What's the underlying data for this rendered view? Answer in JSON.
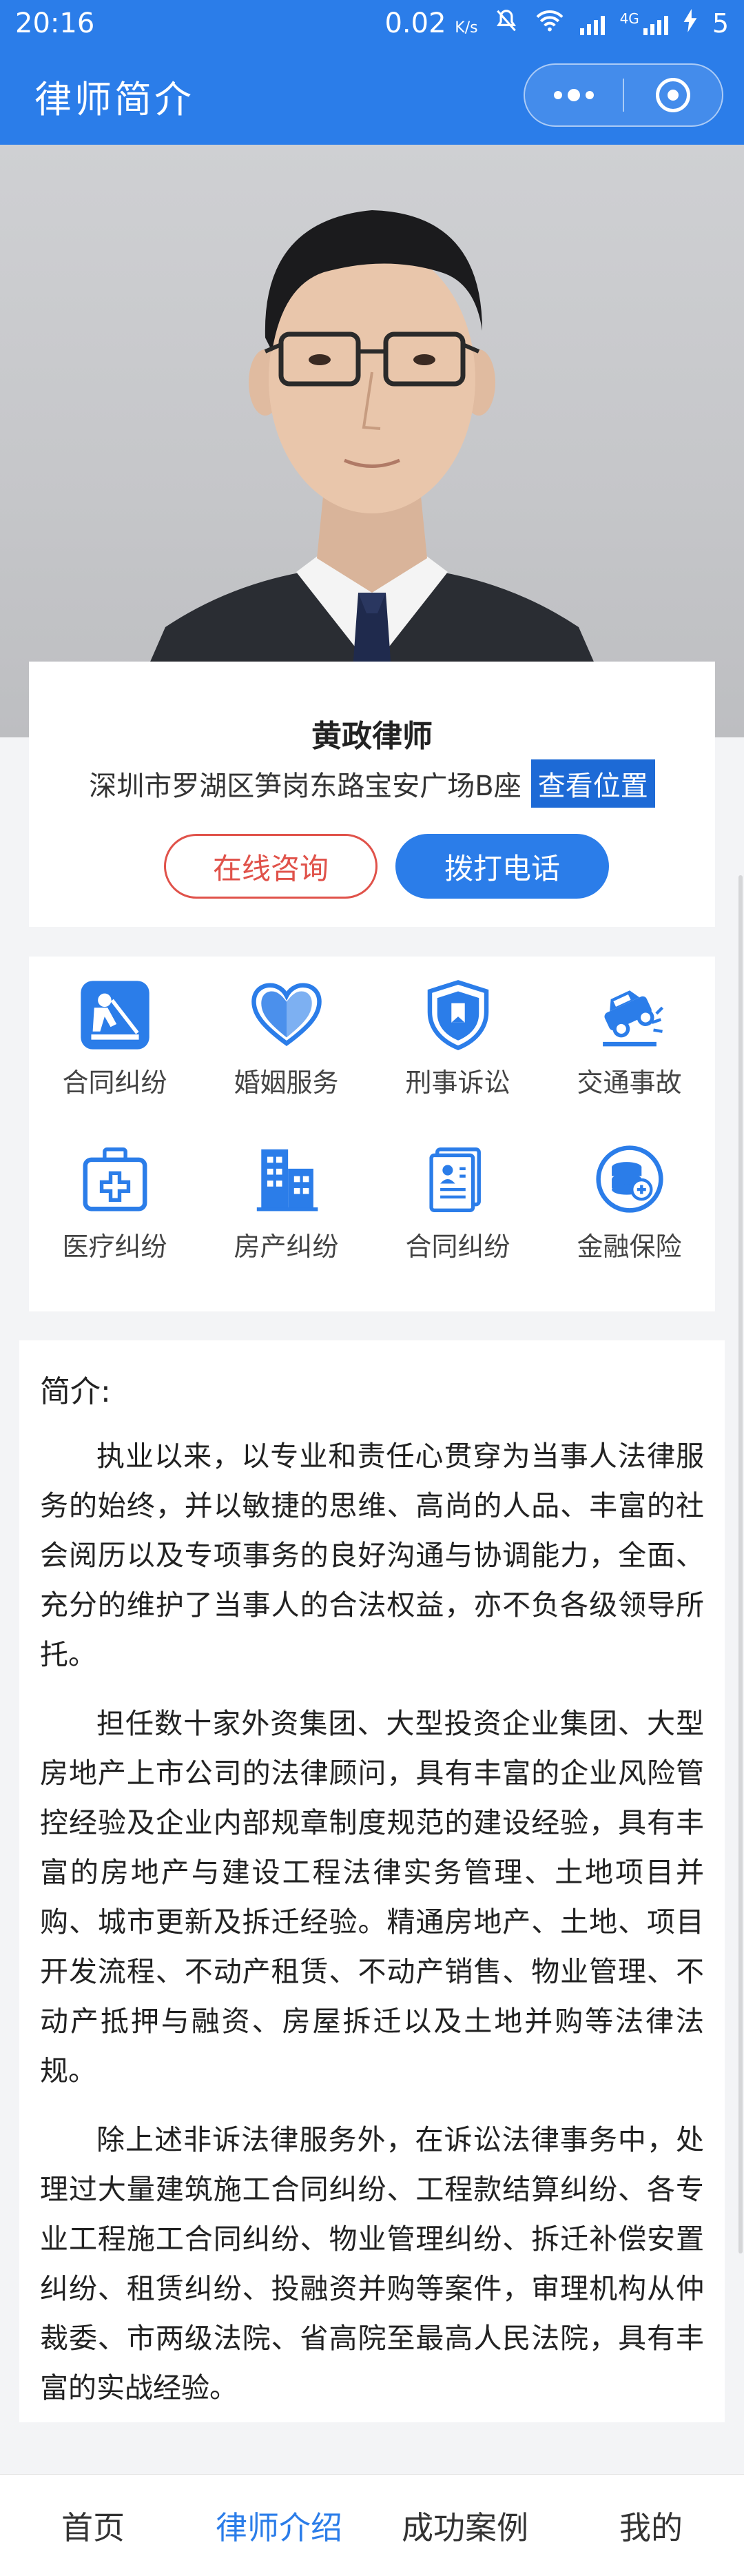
{
  "status_bar": {
    "time": "20:16",
    "speed": "0.02",
    "speed_unit": "K/s",
    "network": "4G",
    "battery": "5"
  },
  "navbar": {
    "title": "律师简介"
  },
  "lawyer": {
    "name": "黄政律师",
    "address": "深圳市罗湖区笋岗东路宝安广场B座",
    "location_button": "查看位置"
  },
  "actions": {
    "consult": "在线咨询",
    "call": "拨打电话"
  },
  "services": [
    {
      "label": "合同纠纷",
      "icon": "worker-icon"
    },
    {
      "label": "婚姻服务",
      "icon": "hearts-icon"
    },
    {
      "label": "刑事诉讼",
      "icon": "shield-icon"
    },
    {
      "label": "交通事故",
      "icon": "car-crash-icon"
    },
    {
      "label": "医疗纠纷",
      "icon": "medical-kit-icon"
    },
    {
      "label": "房产纠纷",
      "icon": "building-icon"
    },
    {
      "label": "合同纠纷",
      "icon": "document-icon"
    },
    {
      "label": "金融保险",
      "icon": "coins-icon"
    }
  ],
  "intro": {
    "title": "简介:",
    "paragraphs": [
      "执业以来，以专业和责任心贯穿为当事人法律服务的始终，并以敏捷的思维、高尚的人品、丰富的社会阅历以及专项事务的良好沟通与协调能力，全面、充分的维护了当事人的合法权益，亦不负各级领导所托。",
      "担任数十家外资集团、大型投资企业集团、大型房地产上市公司的法律顾问，具有丰富的企业风险管控经验及企业内部规章制度规范的建设经验，具有丰富的房地产与建设工程法律实务管理、土地项目并购、城市更新及拆迁经验。精通房地产、土地、项目开发流程、不动产租赁、不动产销售、物业管理、不动产抵押与融资、房屋拆迁以及土地并购等法律法规。",
      "除上述非诉法律服务外，在诉讼法律事务中，处理过大量建筑施工合同纠纷、工程款结算纠纷、各专业工程施工合同纠纷、物业管理纠纷、拆迁补偿安置纠纷、租赁纠纷、投融资并购等案件，审理机构从仲裁委、市两级法院、省高院至最高人民法院，具有丰富的实战经验。"
    ]
  },
  "tabs": [
    "首页",
    "律师介绍",
    "成功案例",
    "我的"
  ],
  "colors": {
    "primary": "#2b7de9",
    "consult_red": "#e0524a",
    "location_btn": "#1d6ad6"
  }
}
